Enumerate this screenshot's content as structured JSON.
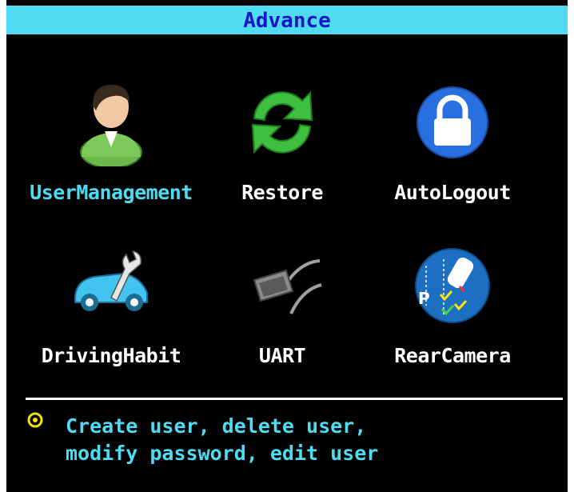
{
  "title": "Advance",
  "menu": {
    "items": [
      {
        "label": "UserManagement",
        "icon": "user-icon",
        "selected": true
      },
      {
        "label": "Restore",
        "icon": "restore-icon",
        "selected": false
      },
      {
        "label": "AutoLogout",
        "icon": "lock-icon",
        "selected": false
      },
      {
        "label": "DrivingHabit",
        "icon": "car-wrench-icon",
        "selected": false
      },
      {
        "label": "UART",
        "icon": "serial-port-icon",
        "selected": false
      },
      {
        "label": "RearCamera",
        "icon": "parking-camera-icon",
        "selected": false
      }
    ]
  },
  "help": {
    "line1": "Create user, delete user,",
    "line2": "modify password, edit user"
  },
  "colors": {
    "title_bar": "#4fdcf2",
    "title_text": "#1414c8",
    "selected_label": "#4fdcf2",
    "label": "#ffffff",
    "background": "#000000",
    "help_text": "#4fdcf2",
    "help_icon": "#f2e400"
  }
}
